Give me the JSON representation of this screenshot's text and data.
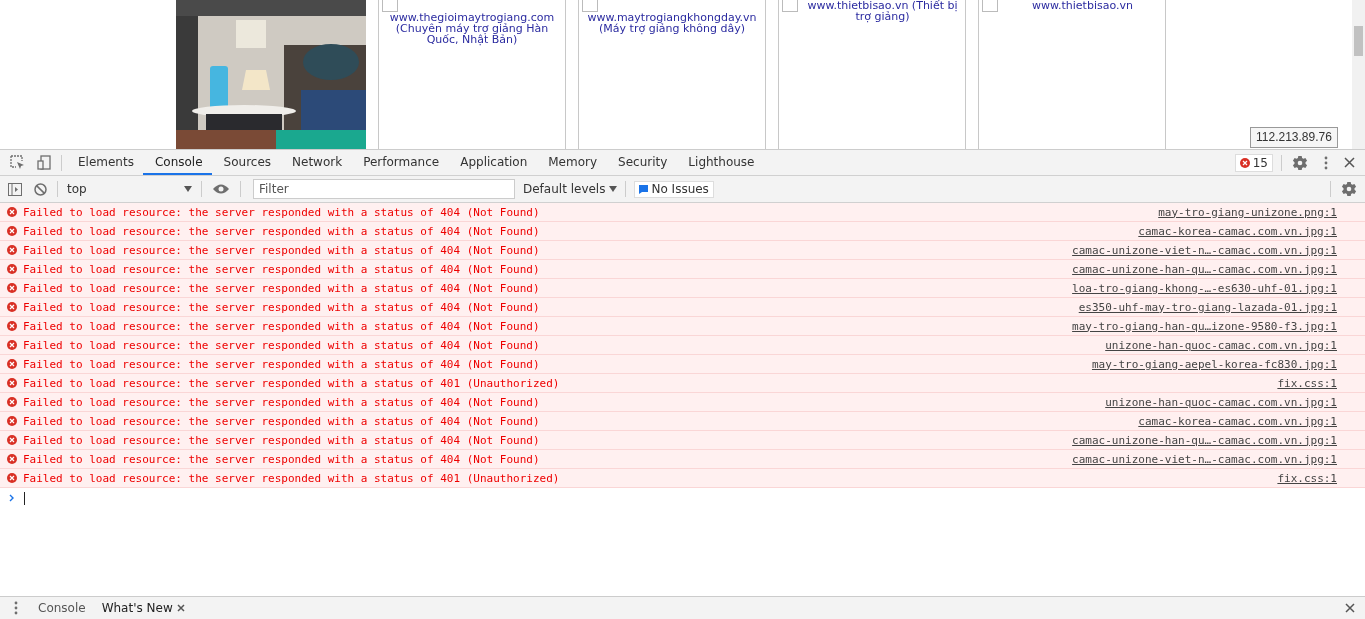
{
  "page": {
    "cards": [
      {
        "checked": false,
        "lines": [
          "www.thegioimaytrogiang.com",
          "(Chuyên máy trợ giảng Hàn Quốc, Nhật Bản)"
        ]
      },
      {
        "checked": false,
        "lines": [
          "www.maytrogiangkhongday.vn",
          "(Máy trợ giảng không dây)"
        ]
      },
      {
        "checked": false,
        "lines": [
          "www.thietbisao.vn (Thiết bị trợ giảng)"
        ]
      },
      {
        "checked": false,
        "lines": [
          "www.thietbisao.vn"
        ]
      }
    ],
    "ip_tooltip": "112.213.89.76"
  },
  "devtools": {
    "tabs": [
      {
        "label": "Elements",
        "selected": false
      },
      {
        "label": "Console",
        "selected": true
      },
      {
        "label": "Sources",
        "selected": false
      },
      {
        "label": "Network",
        "selected": false
      },
      {
        "label": "Performance",
        "selected": false
      },
      {
        "label": "Application",
        "selected": false
      },
      {
        "label": "Memory",
        "selected": false
      },
      {
        "label": "Security",
        "selected": false
      },
      {
        "label": "Lighthouse",
        "selected": false
      }
    ],
    "error_count": "15",
    "context": "top",
    "filter": {
      "placeholder": "Filter"
    },
    "levels": "Default levels",
    "issues": "No Issues",
    "messages": [
      {
        "text": "Failed to load resource: the server responded with a status of 404 (Not Found)",
        "source": "may-tro-giang-unizone.png:1"
      },
      {
        "text": "Failed to load resource: the server responded with a status of 404 (Not Found)",
        "source": "camac-korea-camac.com.vn.jpg:1"
      },
      {
        "text": "Failed to load resource: the server responded with a status of 404 (Not Found)",
        "source": "camac-unizone-viet-n…-camac.com.vn.jpg:1"
      },
      {
        "text": "Failed to load resource: the server responded with a status of 404 (Not Found)",
        "source": "camac-unizone-han-qu…-camac.com.vn.jpg:1"
      },
      {
        "text": "Failed to load resource: the server responded with a status of 404 (Not Found)",
        "source": "loa-tro-giang-khong-…-es630-uhf-01.jpg:1"
      },
      {
        "text": "Failed to load resource: the server responded with a status of 404 (Not Found)",
        "source": "es350-uhf-may-tro-giang-lazada-01.jpg:1"
      },
      {
        "text": "Failed to load resource: the server responded with a status of 404 (Not Found)",
        "source": "may-tro-giang-han-qu…izone-9580-f3.jpg:1"
      },
      {
        "text": "Failed to load resource: the server responded with a status of 404 (Not Found)",
        "source": "unizone-han-quoc-camac.com.vn.jpg:1"
      },
      {
        "text": "Failed to load resource: the server responded with a status of 404 (Not Found)",
        "source": "may-tro-giang-aepel-korea-fc830.jpg:1"
      },
      {
        "text": "Failed to load resource: the server responded with a status of 401 (Unauthorized)",
        "source": "fix.css:1"
      },
      {
        "text": "Failed to load resource: the server responded with a status of 404 (Not Found)",
        "source": "unizone-han-quoc-camac.com.vn.jpg:1"
      },
      {
        "text": "Failed to load resource: the server responded with a status of 404 (Not Found)",
        "source": "camac-korea-camac.com.vn.jpg:1"
      },
      {
        "text": "Failed to load resource: the server responded with a status of 404 (Not Found)",
        "source": "camac-unizone-han-qu…-camac.com.vn.jpg:1"
      },
      {
        "text": "Failed to load resource: the server responded with a status of 404 (Not Found)",
        "source": "camac-unizone-viet-n…-camac.com.vn.jpg:1"
      },
      {
        "text": "Failed to load resource: the server responded with a status of 401 (Unauthorized)",
        "source": "fix.css:1"
      }
    ],
    "drawer": {
      "tabs": [
        {
          "label": "Console",
          "selected": false,
          "closable": false
        },
        {
          "label": "What's New",
          "selected": true,
          "closable": true
        }
      ]
    }
  }
}
